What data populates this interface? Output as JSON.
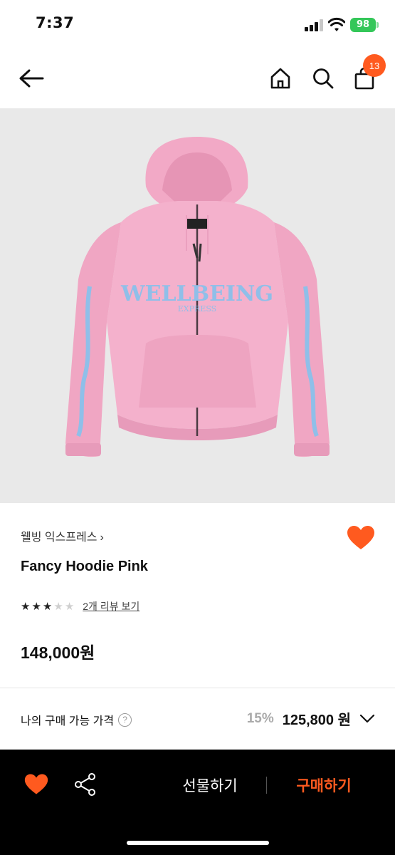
{
  "status_bar": {
    "time": "7:37",
    "battery": "98"
  },
  "nav": {
    "cart_count": "13"
  },
  "product": {
    "brand": "웰빙 익스프레스",
    "title": "Fancy Hoodie Pink",
    "rating": 3,
    "rating_max": 5,
    "review_link": "2개 리뷰 보기",
    "price": "148,000원",
    "image_desc": "pink zip hoodie"
  },
  "member_price": {
    "label": "나의 구매 가능 가격",
    "help": "?",
    "discount": "15%",
    "price": "125,800 원"
  },
  "bottom_bar": {
    "gift_label": "선물하기",
    "buy_label": "구매하기"
  },
  "colors": {
    "accent": "#ff5a1f",
    "image_bg": "#e9e9e9",
    "hoodie": "#f4b1cc",
    "print": "#8fbfe9"
  }
}
